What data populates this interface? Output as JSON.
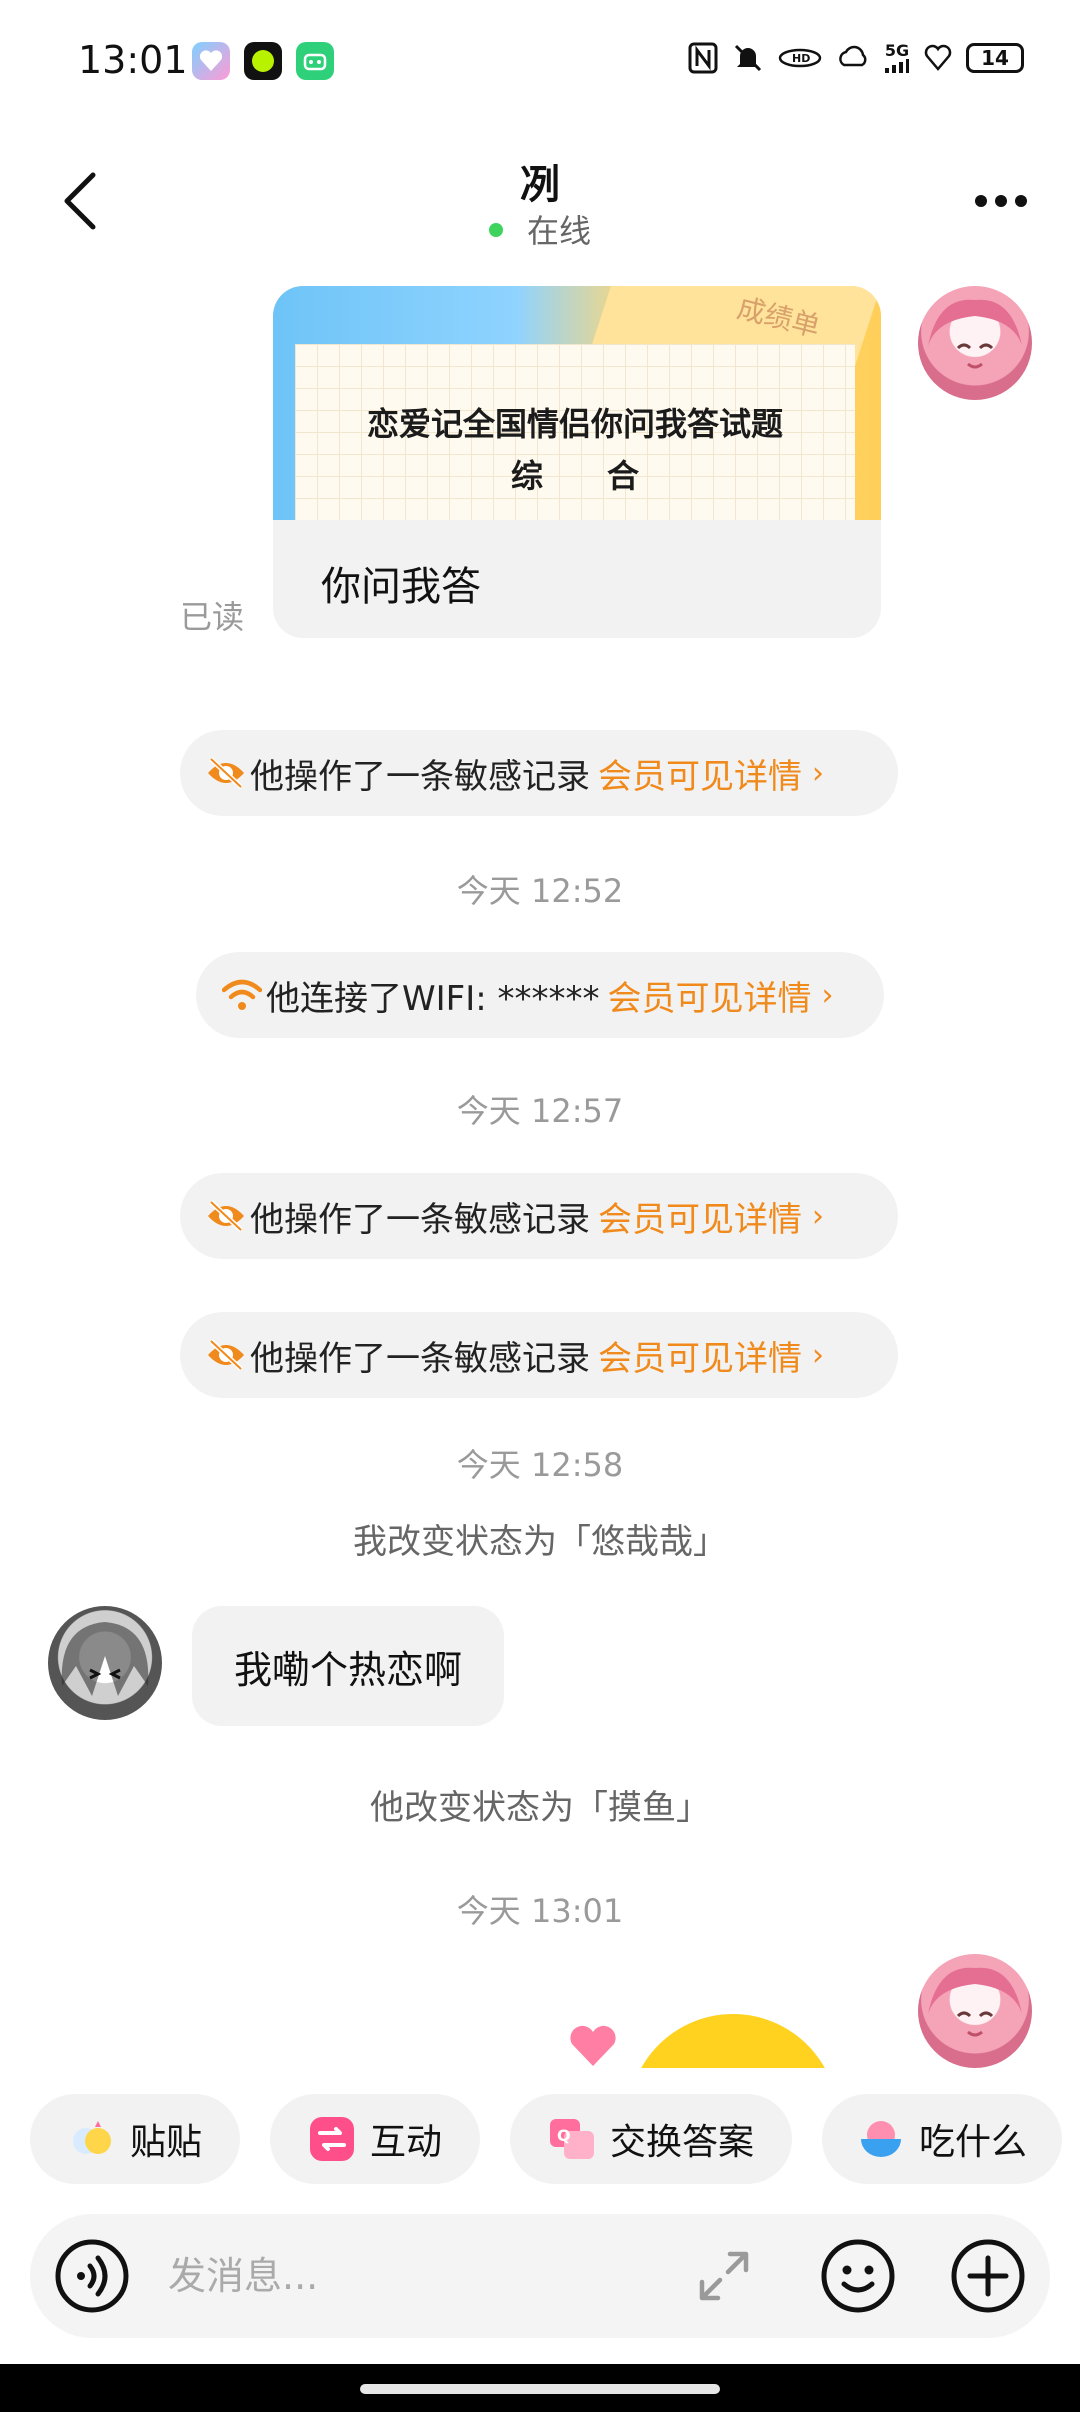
{
  "status_bar": {
    "time": "13:01",
    "network": "5G",
    "battery": "14",
    "app_icons": [
      "heart-app-icon",
      "lime-dot-app-icon",
      "robot-app-icon"
    ],
    "system_icons": [
      "nfc-icon",
      "mute-bell-icon",
      "hd-icon",
      "weather-icon",
      "signal-icon",
      "heart-outline-icon"
    ]
  },
  "header": {
    "title": "冽",
    "presence": "在线",
    "presence_color": "#3dd35c"
  },
  "messages": {
    "quiz_card": {
      "tag": "成绩单",
      "title_line1": "恋爱记全国情侣你问我答试题",
      "title_line2": "综　　合",
      "caption": "你问我答",
      "read_label": "已读"
    },
    "sensitive_1": {
      "text": "他操作了一条敏感记录",
      "link": "会员可见详情",
      "chevron": "›"
    },
    "time_1": "今天 12:52",
    "wifi_1": {
      "text": "他连接了WIFI: ******",
      "link": "会员可见详情",
      "chevron": "›"
    },
    "time_2": "今天 12:57",
    "sensitive_2": {
      "text": "他操作了一条敏感记录",
      "link": "会员可见详情",
      "chevron": "›"
    },
    "sensitive_3": {
      "text": "他操作了一条敏感记录",
      "link": "会员可见详情",
      "chevron": "›"
    },
    "time_3": "今天 12:58",
    "my_status": "我改变状态为「悠哉哉」",
    "partner_bubble": "我嘞个热恋啊",
    "partner_status": "他改变状态为「摸鱼」",
    "time_4": "今天 13:01"
  },
  "quick_actions": [
    {
      "label": "贴贴",
      "icon": "cuddle-icon"
    },
    {
      "label": "互动",
      "icon": "interact-icon"
    },
    {
      "label": "交换答案",
      "icon": "exchange-answer-icon"
    },
    {
      "label": "吃什么",
      "icon": "food-bowl-icon"
    }
  ],
  "composer": {
    "placeholder": "发消息...",
    "value": ""
  },
  "colors": {
    "accent_orange": "#f08a1c",
    "pill_bg": "#f2f2f2",
    "timestamp": "#9a9a9a"
  }
}
